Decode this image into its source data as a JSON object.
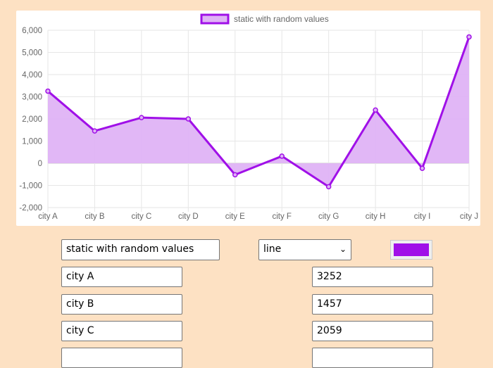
{
  "chart_data": {
    "type": "line",
    "categories": [
      "city A",
      "city B",
      "city C",
      "city D",
      "city E",
      "city F",
      "city G",
      "city H",
      "city I",
      "city J"
    ],
    "series": [
      {
        "name": "static with random values",
        "values": [
          3252,
          1457,
          2059,
          2000,
          -520,
          320,
          -1060,
          2400,
          -230,
          5700
        ],
        "color": "#a010e8",
        "fill": "#dfb3f5"
      }
    ],
    "ylim": [
      -2000,
      6000
    ],
    "yticks": [
      "6,000",
      "5,000",
      "4,000",
      "3,000",
      "2,000",
      "1,000",
      "0",
      "-1,000",
      "-2,000"
    ],
    "fill": true,
    "grid": true,
    "legend": "top"
  },
  "controls": {
    "dataset_name": "static with random values",
    "chart_type": "line",
    "color": "#a010e8"
  },
  "rows": [
    {
      "label": "city A",
      "value": "3252"
    },
    {
      "label": "city B",
      "value": "1457"
    },
    {
      "label": "city C",
      "value": "2059"
    }
  ]
}
